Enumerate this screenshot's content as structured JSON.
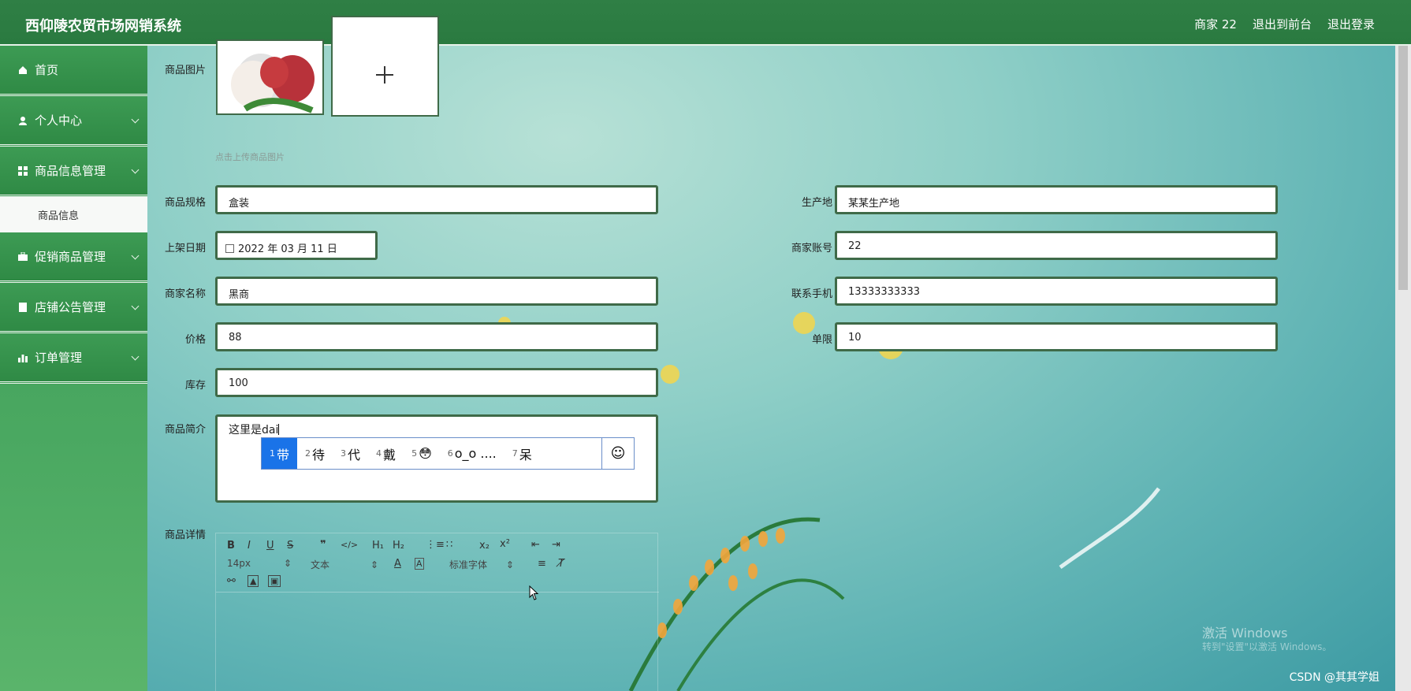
{
  "header": {
    "title": "西仰陵农贸市场网销系统",
    "user_label": "商家 22",
    "back_label": "退出到前台",
    "logout_label": "退出登录"
  },
  "sidebar": {
    "items": [
      {
        "label": "首页",
        "icon": "home-icon"
      },
      {
        "label": "个人中心",
        "icon": "user-icon"
      },
      {
        "label": "商品信息管理",
        "icon": "grid-icon"
      },
      {
        "label": "促销商品管理",
        "icon": "briefcase-icon"
      },
      {
        "label": "店铺公告管理",
        "icon": "book-icon"
      },
      {
        "label": "订单管理",
        "icon": "chart-icon"
      }
    ],
    "sub_item": "商品信息"
  },
  "form": {
    "image_label": "商品图片",
    "image_hint": "点击上传商品图片",
    "spec_label": "商品规格",
    "spec_value": "盒装",
    "origin_label": "生产地",
    "origin_value": "某某生产地",
    "date_label": "上架日期",
    "date_value": "2022 年 03 月 11 日",
    "account_label": "商家账号",
    "account_value": "22",
    "name_label": "商家名称",
    "name_value": "黑商",
    "phone_label": "联系手机",
    "phone_value": "13333333333",
    "price_label": "价格",
    "price_value": "88",
    "limit_label": "单限",
    "limit_value": "10",
    "stock_label": "库存",
    "stock_value": "100",
    "intro_label": "商品简介",
    "intro_value": "这里是dai",
    "detail_label": "商品详情"
  },
  "ime": {
    "candidates": [
      {
        "num": "1",
        "text": "带"
      },
      {
        "num": "2",
        "text": "待"
      },
      {
        "num": "3",
        "text": "代"
      },
      {
        "num": "4",
        "text": "戴"
      },
      {
        "num": "5",
        "text": "😳"
      },
      {
        "num": "6",
        "text": "o_o ...."
      },
      {
        "num": "7",
        "text": "呆"
      }
    ]
  },
  "editor": {
    "font_size": "14px",
    "text_style": "文本",
    "font_family": "标准字体"
  },
  "watermark": "CSDN @其其学姐",
  "windows_activate": "激活 Windows",
  "windows_activate_sub": "转到\"设置\"以激活 Windows。",
  "colors": {
    "header": "#2f7f45",
    "accent": "#1a73e8",
    "field_border": "#3f6a48"
  }
}
